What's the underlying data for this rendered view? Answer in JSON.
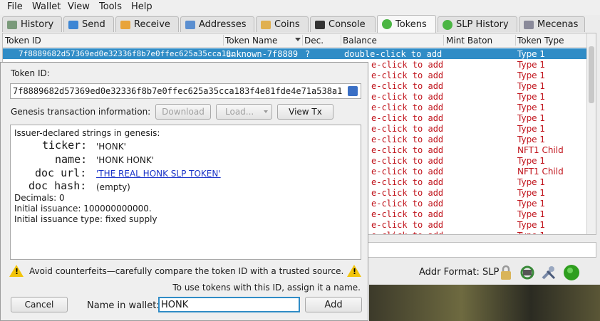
{
  "menu": [
    "File",
    "Wallet",
    "View",
    "Tools",
    "Help"
  ],
  "tabs": [
    {
      "label": "History",
      "icon": "history-icon"
    },
    {
      "label": "Send",
      "icon": "send-icon"
    },
    {
      "label": "Receive",
      "icon": "receive-icon"
    },
    {
      "label": "Addresses",
      "icon": "addresses-icon"
    },
    {
      "label": "Coins",
      "icon": "coins-icon"
    },
    {
      "label": "Console",
      "icon": "console-icon"
    },
    {
      "label": "Tokens",
      "icon": "slp-icon",
      "active": true
    },
    {
      "label": "SLP History",
      "icon": "slp-icon"
    },
    {
      "label": "Mecenas",
      "icon": "tools-icon"
    }
  ],
  "table": {
    "headers": [
      "Token ID",
      "Token Name",
      "Dec.",
      "Balance",
      "Mint Baton",
      "Token Type"
    ],
    "selected_row": {
      "token_id": "7f8889682d57369ed0e32336f8b7e0ffec625a35cca18…",
      "token_name": "unknown-7f8889",
      "decimals": "?",
      "balance": "double-click to add",
      "mint_baton": "",
      "type": "Type 1"
    },
    "rows_balance": "e-click to add",
    "rows_types": [
      "Type 1",
      "Type 1",
      "Type 1",
      "Type 1",
      "Type 1",
      "Type 1",
      "Type 1",
      "Type 1",
      "NFT1 Child",
      "Type 1",
      "NFT1 Child",
      "Type 1",
      "Type 1",
      "Type 1",
      "Type 1",
      "Type 1",
      "Type 1"
    ]
  },
  "status": {
    "addr_format": "Addr Format: SLP"
  },
  "dialog": {
    "token_id_label": "Token ID:",
    "token_id": "7f8889682d57369ed0e32336f8b7e0ffec625a35cca183f4e81fde4e71a538a1",
    "genesis_label": "Genesis transaction information:",
    "download": "Download",
    "load": "Load...",
    "view_tx": "View Tx",
    "issuer_label": "Issuer-declared strings in genesis:",
    "ticker_label": "ticker:",
    "ticker": "'HONK'",
    "name_label": "name:",
    "name": "'HONK HONK'",
    "docurl_label": "doc url:",
    "docurl": "'THE REAL HONK SLP TOKEN'",
    "dochash_label": "doc hash:",
    "dochash": "(empty)",
    "decimals": "Decimals: 0",
    "issuance": "Initial issuance: 100000000000.",
    "issuance_type": "Initial issuance type: fixed supply",
    "warning": "Avoid counterfeits—carefully compare the token ID with a trusted source.",
    "assign_hint": "To use tokens with this ID, assign it a name.",
    "cancel": "Cancel",
    "name_in_wallet_label": "Name in wallet:",
    "name_in_wallet": "HONK",
    "add": "Add"
  }
}
